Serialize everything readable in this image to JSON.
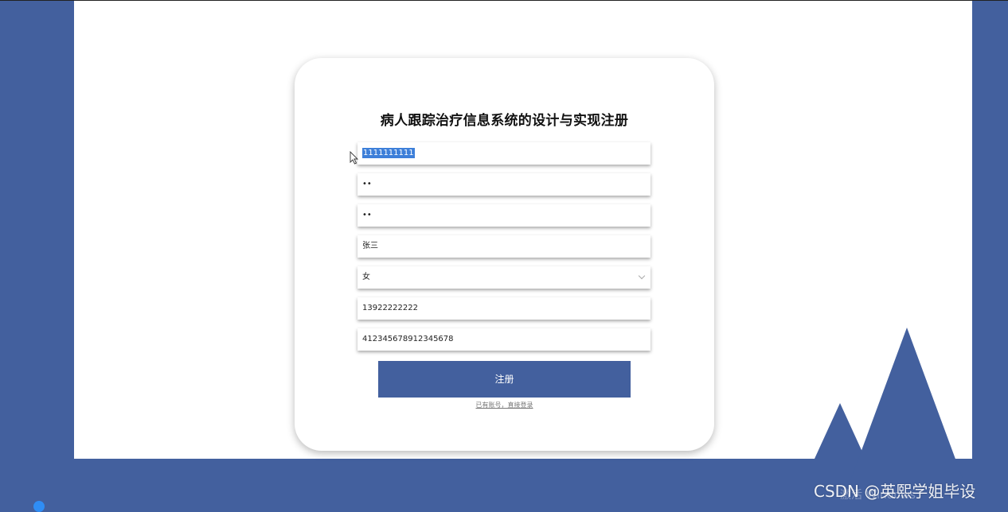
{
  "form": {
    "title": "病人跟踪治疗信息系统的设计与实现注册",
    "account_value": "1111111111",
    "password_value": "••",
    "confirm_password_value": "••",
    "name_value": "张三",
    "gender_value": "女",
    "phone_value": "13922222222",
    "id_card_value": "412345678912345678",
    "submit_label": "注册",
    "login_link": "已有账号，直接登录"
  },
  "watermark": {
    "text": "CSDN @英熙学姐毕设",
    "os_activation": "激活 Windows"
  },
  "colors": {
    "brand": "#43609e",
    "selection": "#3d7fd9"
  }
}
